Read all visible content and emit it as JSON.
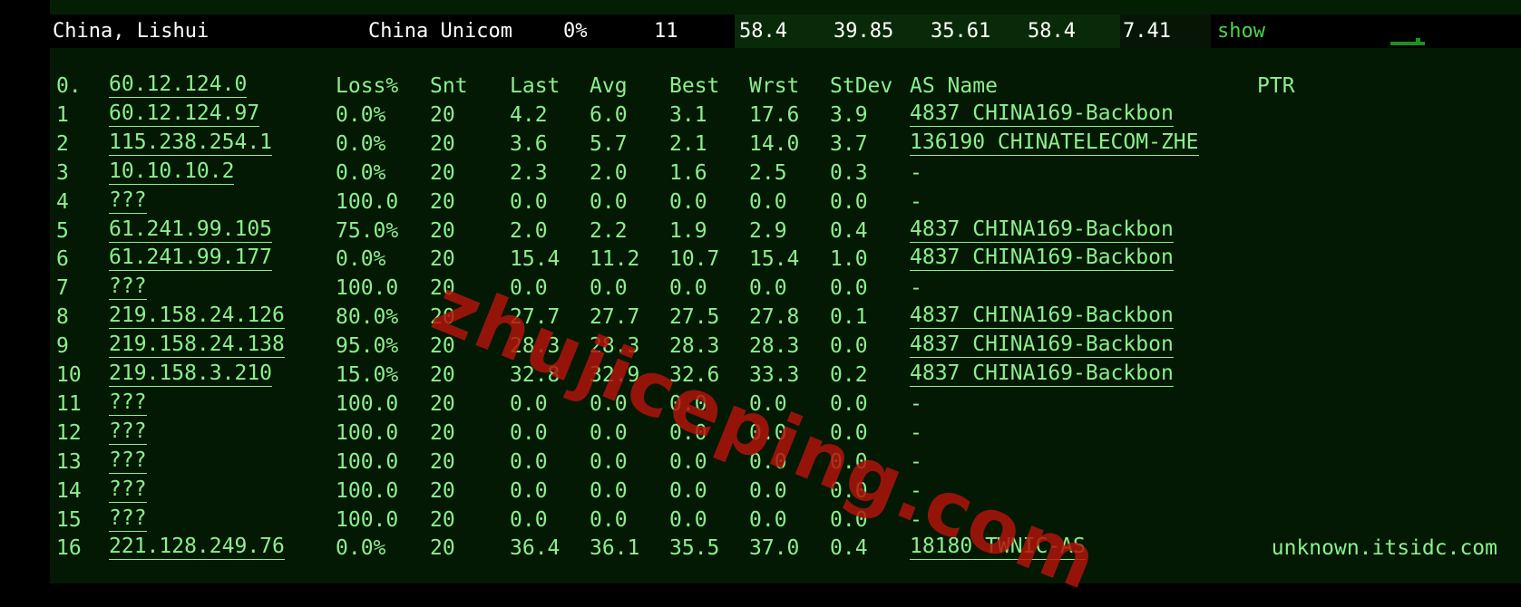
{
  "summary": {
    "location": "China, Lishui",
    "isp": "China Unicom",
    "loss": "0%",
    "sent": "11",
    "last": "58.4",
    "avg": "39.85",
    "best": "35.61",
    "worst": "58.4",
    "stdev": "7.41",
    "show_label": "show"
  },
  "headers": {
    "idx": "0.",
    "host": "60.12.124.0",
    "loss": "Loss%",
    "snt": "Snt",
    "last": "Last",
    "avg": "Avg",
    "best": "Best",
    "wrst": "Wrst",
    "stdev": "StDev",
    "as": "AS Name",
    "ptr": "PTR"
  },
  "hops": [
    {
      "idx": "1",
      "host": "60.12.124.97",
      "loss": "0.0%",
      "snt": "20",
      "last": "4.2",
      "avg": "6.0",
      "best": "3.1",
      "wrst": "17.6",
      "stdev": "3.9",
      "as": "4837  CHINA169-Backbon",
      "ptr": ""
    },
    {
      "idx": "2",
      "host": "115.238.254.1",
      "loss": "0.0%",
      "snt": "20",
      "last": "3.6",
      "avg": "5.7",
      "best": "2.1",
      "wrst": "14.0",
      "stdev": "3.7",
      "as": "136190 CHINATELECOM-ZHE",
      "ptr": ""
    },
    {
      "idx": "3",
      "host": "10.10.10.2",
      "loss": "0.0%",
      "snt": "20",
      "last": "2.3",
      "avg": "2.0",
      "best": "1.6",
      "wrst": "2.5",
      "stdev": "0.3",
      "as": "-",
      "ptr": ""
    },
    {
      "idx": "4",
      "host": "???",
      "loss": "100.0",
      "snt": "20",
      "last": "0.0",
      "avg": "0.0",
      "best": "0.0",
      "wrst": "0.0",
      "stdev": "0.0",
      "as": "-",
      "ptr": ""
    },
    {
      "idx": "5",
      "host": "61.241.99.105",
      "loss": "75.0%",
      "snt": "20",
      "last": "2.0",
      "avg": "2.2",
      "best": "1.9",
      "wrst": "2.9",
      "stdev": "0.4",
      "as": "4837  CHINA169-Backbon",
      "ptr": ""
    },
    {
      "idx": "6",
      "host": "61.241.99.177",
      "loss": "0.0%",
      "snt": "20",
      "last": "15.4",
      "avg": "11.2",
      "best": "10.7",
      "wrst": "15.4",
      "stdev": "1.0",
      "as": "4837  CHINA169-Backbon",
      "ptr": ""
    },
    {
      "idx": "7",
      "host": "???",
      "loss": "100.0",
      "snt": "20",
      "last": "0.0",
      "avg": "0.0",
      "best": "0.0",
      "wrst": "0.0",
      "stdev": "0.0",
      "as": "-",
      "ptr": ""
    },
    {
      "idx": "8",
      "host": "219.158.24.126",
      "loss": "80.0%",
      "snt": "20",
      "last": "27.7",
      "avg": "27.7",
      "best": "27.5",
      "wrst": "27.8",
      "stdev": "0.1",
      "as": "4837  CHINA169-Backbon",
      "ptr": ""
    },
    {
      "idx": "9",
      "host": "219.158.24.138",
      "loss": "95.0%",
      "snt": "20",
      "last": "28.3",
      "avg": "28.3",
      "best": "28.3",
      "wrst": "28.3",
      "stdev": "0.0",
      "as": "4837  CHINA169-Backbon",
      "ptr": ""
    },
    {
      "idx": "10",
      "host": "219.158.3.210",
      "loss": "15.0%",
      "snt": "20",
      "last": "32.8",
      "avg": "32.9",
      "best": "32.6",
      "wrst": "33.3",
      "stdev": "0.2",
      "as": "4837  CHINA169-Backbon",
      "ptr": ""
    },
    {
      "idx": "11",
      "host": "???",
      "loss": "100.0",
      "snt": "20",
      "last": "0.0",
      "avg": "0.0",
      "best": "0.0",
      "wrst": "0.0",
      "stdev": "0.0",
      "as": "-",
      "ptr": ""
    },
    {
      "idx": "12",
      "host": "???",
      "loss": "100.0",
      "snt": "20",
      "last": "0.0",
      "avg": "0.0",
      "best": "0.0",
      "wrst": "0.0",
      "stdev": "0.0",
      "as": "-",
      "ptr": ""
    },
    {
      "idx": "13",
      "host": "???",
      "loss": "100.0",
      "snt": "20",
      "last": "0.0",
      "avg": "0.0",
      "best": "0.0",
      "wrst": "0.0",
      "stdev": "0.0",
      "as": "-",
      "ptr": ""
    },
    {
      "idx": "14",
      "host": "???",
      "loss": "100.0",
      "snt": "20",
      "last": "0.0",
      "avg": "0.0",
      "best": "0.0",
      "wrst": "0.0",
      "stdev": "0.0",
      "as": "-",
      "ptr": ""
    },
    {
      "idx": "15",
      "host": "???",
      "loss": "100.0",
      "snt": "20",
      "last": "0.0",
      "avg": "0.0",
      "best": "0.0",
      "wrst": "0.0",
      "stdev": "0.0",
      "as": "-",
      "ptr": ""
    },
    {
      "idx": "16",
      "host": "221.128.249.76",
      "loss": "0.0%",
      "snt": "20",
      "last": "36.4",
      "avg": "36.1",
      "best": "35.5",
      "wrst": "37.0",
      "stdev": "0.4",
      "as": "18180 TWNIC-AS",
      "ptr": "unknown.itsidc.com"
    }
  ],
  "watermark": "zhujiceping.com",
  "colors": {
    "text": "#8cf08c",
    "panel_bg": "#031903",
    "summary_text": "#ffffff",
    "show_link": "#4cd24c",
    "watermark": "#b0140a"
  }
}
